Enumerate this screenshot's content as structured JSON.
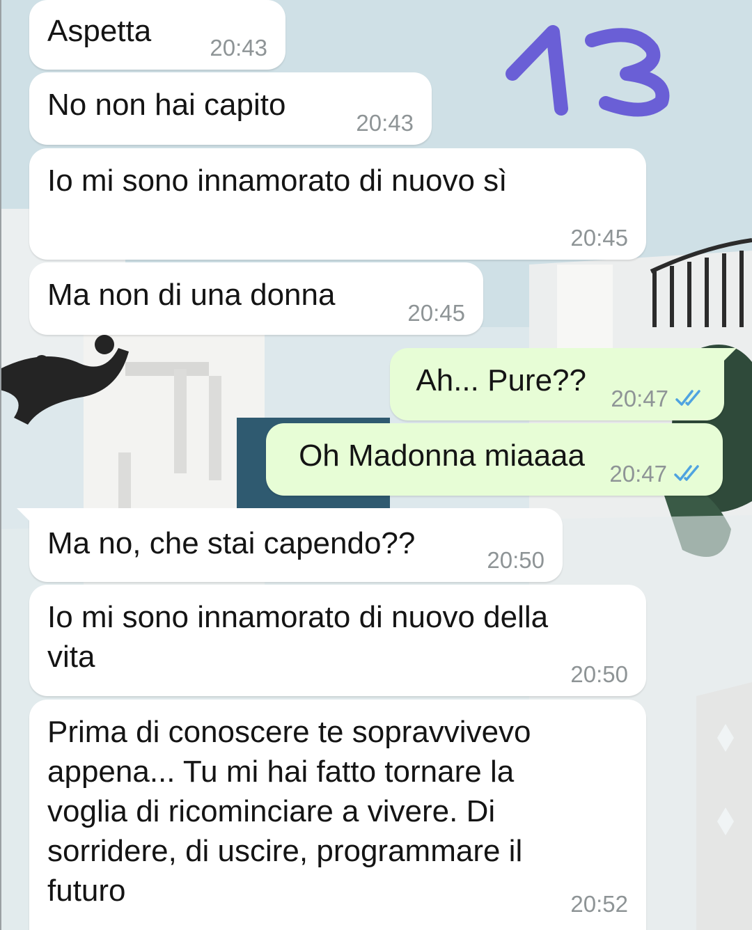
{
  "annotation": {
    "number": "13",
    "color": "#6a5fd6"
  },
  "colors": {
    "incoming": "#ffffff",
    "outgoing": "#e7fdd6",
    "tick_read": "#4fa3e0"
  },
  "messages": [
    {
      "direction": "incoming",
      "text": "Aspetta",
      "time": "20:43"
    },
    {
      "direction": "incoming",
      "text": "No non hai capito",
      "time": "20:43"
    },
    {
      "direction": "incoming",
      "text": "Io mi sono innamorato di nuovo sì",
      "time": "20:45"
    },
    {
      "direction": "incoming",
      "text": "Ma non di una donna",
      "time": "20:45"
    },
    {
      "direction": "outgoing",
      "text": "Ah... Pure??",
      "time": "20:47",
      "status": "read"
    },
    {
      "direction": "outgoing",
      "text": "Oh Madonna miaaaa",
      "time": "20:47",
      "status": "read"
    },
    {
      "direction": "incoming",
      "text": "Ma no, che stai capendo??",
      "time": "20:50"
    },
    {
      "direction": "incoming",
      "text": "Io mi sono innamorato di nuovo della\nvita",
      "time": "20:50"
    },
    {
      "direction": "incoming",
      "text": "Prima di conoscere te sopravvivevo\nappena... Tu mi hai fatto tornare la\nvoglia di ricominciare a vivere. Di\nsorridere, di uscire, programmare il\nfuturo",
      "time": "20:52"
    }
  ]
}
